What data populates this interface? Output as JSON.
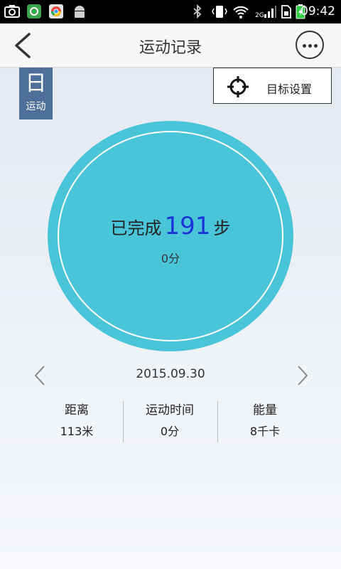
{
  "status_bar": {
    "time": "09:42",
    "icons": [
      "camera-icon",
      "app-icon",
      "chrome-icon",
      "android-icon",
      "bluetooth-icon",
      "vibrate-icon",
      "wifi-icon",
      "signal-2g-icon",
      "sim-icon",
      "battery-charging-icon"
    ],
    "network_label": "2G"
  },
  "header": {
    "title": "运动记录",
    "back_icon": "chevron-left-icon",
    "more_icon": "more-icon"
  },
  "day_badge": {
    "big": "日",
    "small": "运动"
  },
  "goal_button": {
    "icon": "crosshair-icon",
    "label": "目标设置"
  },
  "progress": {
    "prefix": "已完成",
    "steps": "191",
    "suffix": "步",
    "minutes": "0分",
    "ring_color": "#4ac4d9",
    "steps_color": "#1a35d8"
  },
  "date_nav": {
    "date": "2015.09.30",
    "prev_icon": "chevron-left-icon",
    "next_icon": "chevron-right-icon"
  },
  "stats": [
    {
      "label": "距离",
      "value": "113米"
    },
    {
      "label": "运动时间",
      "value": "0分"
    },
    {
      "label": "能量",
      "value": "8千卡"
    }
  ]
}
